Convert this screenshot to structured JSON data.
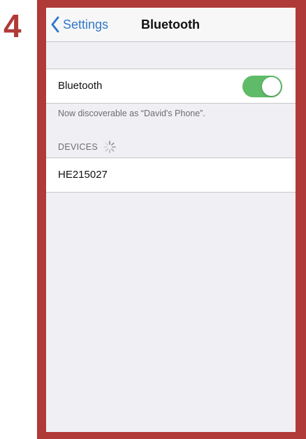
{
  "step": {
    "number": "4"
  },
  "navbar": {
    "back_label": "Settings",
    "title": "Bluetooth"
  },
  "bluetooth_row": {
    "label": "Bluetooth",
    "toggle_on": true
  },
  "discoverable_note": "Now discoverable as “David's Phone”.",
  "devices_section": {
    "header": "DEVICES",
    "items": [
      {
        "name": "HE215027"
      }
    ]
  },
  "icons": {
    "back": "chevron-left-icon",
    "loading": "spinner-icon"
  },
  "colors": {
    "accent_blue": "#3478c6",
    "toggle_green": "#5fbb68",
    "frame_red": "#b03a37",
    "background_gray": "#efeff4"
  }
}
